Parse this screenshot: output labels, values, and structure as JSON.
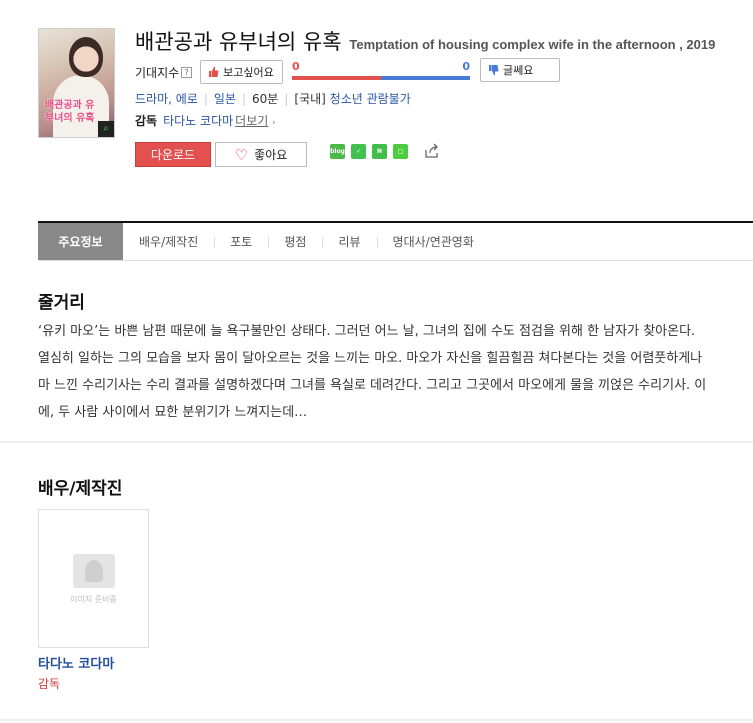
{
  "movie": {
    "title_ko": "배관공과 유부녀의 유혹",
    "title_en": "Temptation of housing complex wife in the afternoon , 2019",
    "poster_text": "배관공과 유부녀의 유혹"
  },
  "expect": {
    "label": "기대지수",
    "help": "?",
    "want_label": "보고싶어요",
    "want_count": "0",
    "dislike_count": "0",
    "dislike_label": "글쎄요",
    "want_ratio": 0.5,
    "colors": {
      "want": "#e35050",
      "dislike": "#4a7ad8"
    }
  },
  "info": {
    "genre": "드라마, 에로",
    "country": "일본",
    "runtime": "60분",
    "rating_prefix": "[국내]",
    "rating": "청소년 관람불가"
  },
  "director": {
    "label": "감독",
    "name": "타다노 코다마",
    "more": "더보기"
  },
  "actions": {
    "download": "다운로드",
    "like": "좋아요"
  },
  "share": [
    {
      "icon": "blog-icon",
      "text": "blog",
      "color": "#4cb848"
    },
    {
      "icon": "band-icon",
      "text": "",
      "color": "#41c14f"
    },
    {
      "icon": "kakaostory-icon",
      "text": "",
      "color": "#3fbf4a"
    },
    {
      "icon": "line-icon",
      "text": "",
      "color": "#4ecc3f"
    }
  ],
  "tabs": [
    "주요정보",
    "배우/제작진",
    "포토",
    "평점",
    "리뷰",
    "명대사/연관영화"
  ],
  "synopsis": {
    "heading": "줄거리",
    "text": "‘유키 마오’는 바쁜 남편 때문에 늘 욕구불만인 상태다. 그러던 어느 날, 그녀의 집에 수도 점검을 위해 한 남자가 찾아온다. 열심히 일하는 그의 모습을 보자 몸이 달아오르는 것을 느끼는 마오. 마오가 자신을 힐끔힐끔 쳐다본다는 것을 어렴풋하게나마 느낀 수리기사는 수리 결과를 설명하겠다며 그녀를 욕실로 데려간다. 그리고 그곳에서 마오에게 물을 끼얹은 수리기사. 이에, 두 사람 사이에서 묘한 분위기가 느껴지는데…"
  },
  "cast": {
    "heading": "배우/제작진",
    "members": [
      {
        "name": "타다노 코다마",
        "role": "감독",
        "placeholder": "이미지 준비중"
      }
    ]
  }
}
